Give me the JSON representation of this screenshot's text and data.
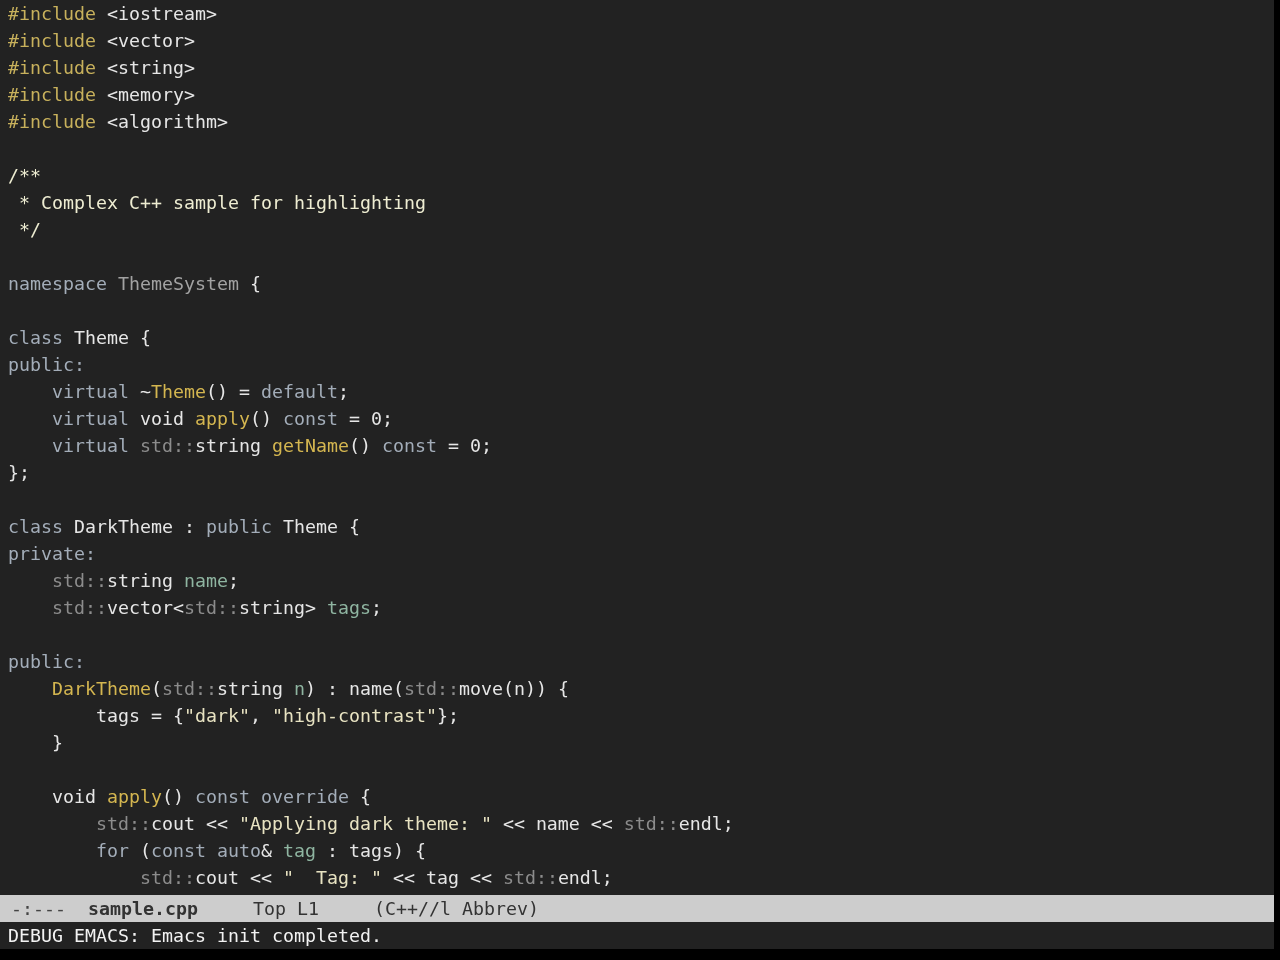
{
  "editor": {
    "lines": [
      {
        "kind": "code",
        "tokens": [
          {
            "text": "#include",
            "kind": "preprocessor"
          },
          {
            "text": " <iostream>",
            "kind": "plain"
          }
        ]
      },
      {
        "kind": "code",
        "tokens": [
          {
            "text": "#include",
            "kind": "preprocessor"
          },
          {
            "text": " <vector>",
            "kind": "plain"
          }
        ]
      },
      {
        "kind": "code",
        "tokens": [
          {
            "text": "#include",
            "kind": "preprocessor"
          },
          {
            "text": " <string>",
            "kind": "plain"
          }
        ]
      },
      {
        "kind": "code",
        "tokens": [
          {
            "text": "#include",
            "kind": "preprocessor"
          },
          {
            "text": " <memory>",
            "kind": "plain"
          }
        ]
      },
      {
        "kind": "code",
        "tokens": [
          {
            "text": "#include",
            "kind": "preprocessor"
          },
          {
            "text": " <algorithm>",
            "kind": "plain"
          }
        ]
      },
      {
        "kind": "blank"
      },
      {
        "kind": "code",
        "tokens": [
          {
            "text": "/**",
            "kind": "comment"
          }
        ]
      },
      {
        "kind": "code",
        "tokens": [
          {
            "text": " * Complex C++ sample for highlighting",
            "kind": "comment"
          }
        ]
      },
      {
        "kind": "code",
        "tokens": [
          {
            "text": " */",
            "kind": "comment"
          }
        ]
      },
      {
        "kind": "blank"
      },
      {
        "kind": "code",
        "tokens": [
          {
            "text": "namespace",
            "kind": "keyword"
          },
          {
            "text": " ThemeSystem",
            "kind": "namespace"
          },
          {
            "text": " {",
            "kind": "plain"
          }
        ]
      },
      {
        "kind": "blank"
      },
      {
        "kind": "code",
        "tokens": [
          {
            "text": "class",
            "kind": "keyword"
          },
          {
            "text": " Theme {",
            "kind": "plain"
          }
        ]
      },
      {
        "kind": "code",
        "tokens": [
          {
            "text": "public:",
            "kind": "keyword"
          }
        ]
      },
      {
        "kind": "code",
        "tokens": [
          {
            "text": "    virtual",
            "kind": "keyword"
          },
          {
            "text": " ~",
            "kind": "plain"
          },
          {
            "text": "Theme",
            "kind": "function"
          },
          {
            "text": "() = ",
            "kind": "plain"
          },
          {
            "text": "default",
            "kind": "keyword"
          },
          {
            "text": ";",
            "kind": "plain"
          }
        ]
      },
      {
        "kind": "code",
        "tokens": [
          {
            "text": "    virtual",
            "kind": "keyword"
          },
          {
            "text": " void ",
            "kind": "plain"
          },
          {
            "text": "apply",
            "kind": "function"
          },
          {
            "text": "() ",
            "kind": "plain"
          },
          {
            "text": "const",
            "kind": "keyword"
          },
          {
            "text": " = 0;",
            "kind": "plain"
          }
        ]
      },
      {
        "kind": "code",
        "tokens": [
          {
            "text": "    virtual",
            "kind": "keyword"
          },
          {
            "text": " std::",
            "kind": "qualifier"
          },
          {
            "text": "string ",
            "kind": "plain"
          },
          {
            "text": "getName",
            "kind": "function"
          },
          {
            "text": "() ",
            "kind": "plain"
          },
          {
            "text": "const",
            "kind": "keyword"
          },
          {
            "text": " = 0;",
            "kind": "plain"
          }
        ]
      },
      {
        "kind": "code",
        "tokens": [
          {
            "text": "};",
            "kind": "plain"
          }
        ]
      },
      {
        "kind": "blank"
      },
      {
        "kind": "code",
        "tokens": [
          {
            "text": "class",
            "kind": "keyword"
          },
          {
            "text": " DarkTheme : ",
            "kind": "plain"
          },
          {
            "text": "public",
            "kind": "keyword"
          },
          {
            "text": " Theme {",
            "kind": "plain"
          }
        ]
      },
      {
        "kind": "code",
        "tokens": [
          {
            "text": "private:",
            "kind": "keyword"
          }
        ]
      },
      {
        "kind": "code",
        "tokens": [
          {
            "text": "    std::",
            "kind": "qualifier"
          },
          {
            "text": "string ",
            "kind": "plain"
          },
          {
            "text": "name",
            "kind": "variable"
          },
          {
            "text": ";",
            "kind": "plain"
          }
        ]
      },
      {
        "kind": "code",
        "tokens": [
          {
            "text": "    std::",
            "kind": "qualifier"
          },
          {
            "text": "vector<",
            "kind": "plain"
          },
          {
            "text": "std::",
            "kind": "qualifier"
          },
          {
            "text": "string> ",
            "kind": "plain"
          },
          {
            "text": "tags",
            "kind": "variable"
          },
          {
            "text": ";",
            "kind": "plain"
          }
        ]
      },
      {
        "kind": "blank"
      },
      {
        "kind": "code",
        "tokens": [
          {
            "text": "public:",
            "kind": "keyword"
          }
        ]
      },
      {
        "kind": "code",
        "tokens": [
          {
            "text": "    DarkTheme",
            "kind": "function"
          },
          {
            "text": "(",
            "kind": "plain"
          },
          {
            "text": "std::",
            "kind": "qualifier"
          },
          {
            "text": "string ",
            "kind": "plain"
          },
          {
            "text": "n",
            "kind": "variable"
          },
          {
            "text": ") : name(",
            "kind": "plain"
          },
          {
            "text": "std::",
            "kind": "qualifier"
          },
          {
            "text": "move(n)) {",
            "kind": "plain"
          }
        ]
      },
      {
        "kind": "code",
        "tokens": [
          {
            "text": "        tags = {",
            "kind": "plain"
          },
          {
            "text": "\"dark\"",
            "kind": "string"
          },
          {
            "text": ", ",
            "kind": "plain"
          },
          {
            "text": "\"high-contrast\"",
            "kind": "string"
          },
          {
            "text": "};",
            "kind": "plain"
          }
        ]
      },
      {
        "kind": "code",
        "tokens": [
          {
            "text": "    }",
            "kind": "plain"
          }
        ]
      },
      {
        "kind": "blank"
      },
      {
        "kind": "code",
        "tokens": [
          {
            "text": "    void ",
            "kind": "plain"
          },
          {
            "text": "apply",
            "kind": "function"
          },
          {
            "text": "() ",
            "kind": "plain"
          },
          {
            "text": "const override",
            "kind": "keyword"
          },
          {
            "text": " {",
            "kind": "plain"
          }
        ]
      },
      {
        "kind": "code",
        "tokens": [
          {
            "text": "        std::",
            "kind": "qualifier"
          },
          {
            "text": "cout << ",
            "kind": "plain"
          },
          {
            "text": "\"Applying dark theme: \"",
            "kind": "string"
          },
          {
            "text": " << name << ",
            "kind": "plain"
          },
          {
            "text": "std::",
            "kind": "qualifier"
          },
          {
            "text": "endl;",
            "kind": "plain"
          }
        ]
      },
      {
        "kind": "code",
        "tokens": [
          {
            "text": "        for",
            "kind": "keyword"
          },
          {
            "text": " (",
            "kind": "plain"
          },
          {
            "text": "const auto",
            "kind": "keyword"
          },
          {
            "text": "& ",
            "kind": "plain"
          },
          {
            "text": "tag",
            "kind": "variable"
          },
          {
            "text": " : tags) {",
            "kind": "plain"
          }
        ]
      },
      {
        "kind": "code",
        "tokens": [
          {
            "text": "            std::",
            "kind": "qualifier"
          },
          {
            "text": "cout << ",
            "kind": "plain"
          },
          {
            "text": "\"  Tag: \"",
            "kind": "string"
          },
          {
            "text": " << tag << ",
            "kind": "plain"
          },
          {
            "text": "std::",
            "kind": "qualifier"
          },
          {
            "text": "endl;",
            "kind": "plain"
          }
        ]
      }
    ]
  },
  "mode_line": {
    "status": "-:---",
    "buffer_name": "sample.cpp",
    "position": "Top L1",
    "modes": "(C++//l Abbrev)"
  },
  "echo_area": {
    "message": "DEBUG EMACS: Emacs init completed."
  }
}
